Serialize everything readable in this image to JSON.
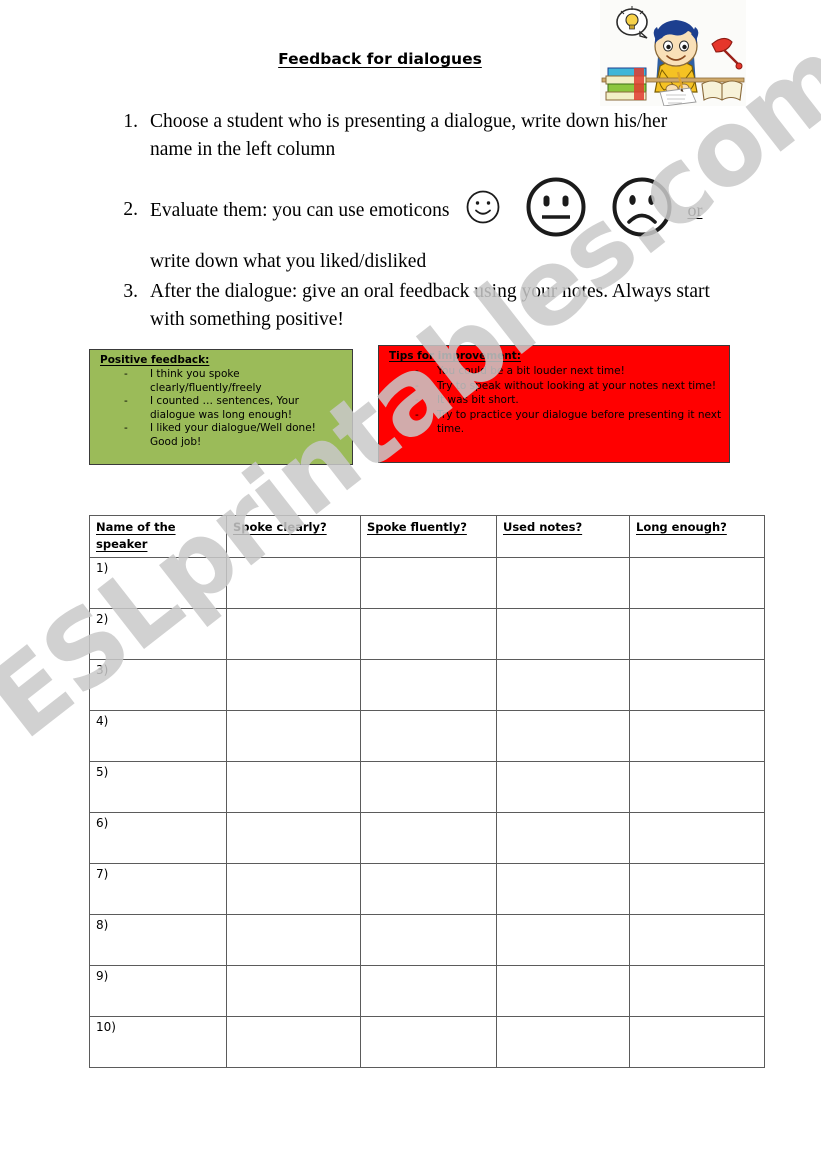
{
  "document": {
    "title": "Feedback for dialogues",
    "watermark": "ESLprintables.com"
  },
  "clipart": {
    "name": "boy-studying-at-desk-clipart",
    "description": "Cartoon boy with blue hair and yellow shirt sitting at a desk writing, with a lightbulb thought bubble, a stack of books and a red desk lamp"
  },
  "instructions": [
    {
      "number": "1.",
      "text": "Choose a student who is presenting a dialogue, write down his/her name in the left column"
    },
    {
      "number": "2.",
      "lead": "Evaluate them: you can use emoticons",
      "or": "or",
      "continuation": "write down what you liked/disliked",
      "emoticons": [
        {
          "name": "smiling-face-emoticon",
          "label": "happy"
        },
        {
          "name": "neutral-face-emoticon",
          "label": "neutral"
        },
        {
          "name": "frowning-face-emoticon",
          "label": "sad"
        }
      ]
    },
    {
      "number": "3.",
      "text": "After the dialogue: give an oral feedback using your notes. Always start with something positive!"
    }
  ],
  "feedback_boxes": [
    {
      "id": "positive",
      "title": "Positive feedback:",
      "color": "#9BBB59",
      "items": [
        "I think you spoke clearly/fluently/freely",
        "I counted … sentences, Your dialogue was long enough!",
        "I liked your dialogue/Well done! Good job!"
      ]
    },
    {
      "id": "improvement",
      "title": "Tips for improvement:",
      "color": "#FF0000",
      "items": [
        "You could be a bit louder next time!",
        "Try to speak without looking at your notes next time!",
        "It was bit short.",
        "Try to practice your dialogue before presenting it next time."
      ]
    }
  ],
  "table": {
    "headers": [
      "Name of the speaker",
      "Spoke clearly?",
      "Spoke fluently?",
      "Used notes?",
      "Long enough?"
    ],
    "rows": [
      {
        "label": "1)",
        "cells": [
          "",
          "",
          "",
          ""
        ]
      },
      {
        "label": "2)",
        "cells": [
          "",
          "",
          "",
          ""
        ]
      },
      {
        "label": "3)",
        "cells": [
          "",
          "",
          "",
          ""
        ]
      },
      {
        "label": "4)",
        "cells": [
          "",
          "",
          "",
          ""
        ]
      },
      {
        "label": "5)",
        "cells": [
          "",
          "",
          "",
          ""
        ]
      },
      {
        "label": "6)",
        "cells": [
          "",
          "",
          "",
          ""
        ]
      },
      {
        "label": "7)",
        "cells": [
          "",
          "",
          "",
          ""
        ]
      },
      {
        "label": "8)",
        "cells": [
          "",
          "",
          "",
          ""
        ]
      },
      {
        "label": "9)",
        "cells": [
          "",
          "",
          "",
          ""
        ]
      },
      {
        "label": "10)",
        "cells": [
          "",
          "",
          "",
          ""
        ]
      }
    ]
  }
}
